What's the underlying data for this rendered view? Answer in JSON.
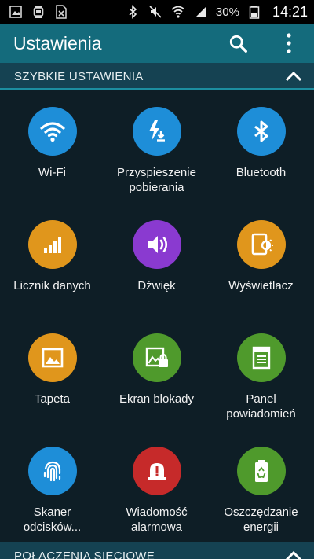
{
  "status_bar": {
    "notification_icons": [
      "gallery-icon",
      "watch-icon",
      "spreadsheet-icon"
    ],
    "system_icons": [
      "bluetooth-icon",
      "mute-icon",
      "wifi-icon",
      "signal-icon"
    ],
    "battery": "30%",
    "time": "14:21"
  },
  "action_bar": {
    "title": "Ustawienia",
    "search_icon": "search-icon",
    "more_icon": "more-vertical-icon"
  },
  "sections": {
    "quick": {
      "label": "SZYBKIE USTAWIENIA",
      "icon": "chevron-up-icon"
    },
    "network": {
      "label": "POŁĄCZENIA SIECIOWE",
      "icon": "chevron-up-icon"
    }
  },
  "tiles": [
    {
      "label": "Wi-Fi",
      "icon": "wifi-icon",
      "color": "#1e8ed8"
    },
    {
      "label": "Przyspieszenie\npobierania",
      "icon": "download-booster-icon",
      "color": "#1e8ed8"
    },
    {
      "label": "Bluetooth",
      "icon": "bluetooth-icon",
      "color": "#1e8ed8"
    },
    {
      "label": "Licznik danych",
      "icon": "data-usage-icon",
      "color": "#e0961c"
    },
    {
      "label": "Dźwięk",
      "icon": "volume-icon",
      "color": "#8a3ad0"
    },
    {
      "label": "Wyświetlacz",
      "icon": "display-icon",
      "color": "#e0961c"
    },
    {
      "label": "Tapeta",
      "icon": "wallpaper-icon",
      "color": "#e0961c"
    },
    {
      "label": "Ekran blokady",
      "icon": "lock-screen-icon",
      "color": "#4f9a2c"
    },
    {
      "label": "Panel\npowiadomień",
      "icon": "notification-panel-icon",
      "color": "#4f9a2c"
    },
    {
      "label": "Skaner\nodcisków...",
      "icon": "fingerprint-icon",
      "color": "#1e8ed8"
    },
    {
      "label": "Wiadomość\nalarmowa",
      "icon": "emergency-icon",
      "color": "#c62a2a"
    },
    {
      "label": "Oszczędzanie\nenergii",
      "icon": "power-saving-icon",
      "color": "#4f9a2c"
    }
  ]
}
